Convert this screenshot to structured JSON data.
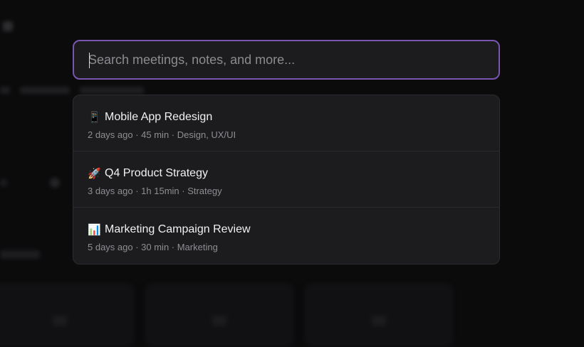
{
  "search": {
    "placeholder": "Search meetings, notes, and more...",
    "value": ""
  },
  "results": [
    {
      "icon": "phone-icon",
      "emoji": "📱",
      "title": "Mobile App Redesign",
      "meta": "2 days ago · 45 min · Design, UX/UI"
    },
    {
      "icon": "rocket-icon",
      "emoji": "🚀",
      "title": "Q4 Product Strategy",
      "meta": "3 days ago · 1h 15min · Strategy"
    },
    {
      "icon": "bar-chart-icon",
      "emoji": "📊",
      "title": "Marketing Campaign Review",
      "meta": "5 days ago · 30 min · Marketing"
    }
  ],
  "colors": {
    "accent": "#7a55b0",
    "panel": "#1c1c1e",
    "background": "#0b0b0c"
  }
}
